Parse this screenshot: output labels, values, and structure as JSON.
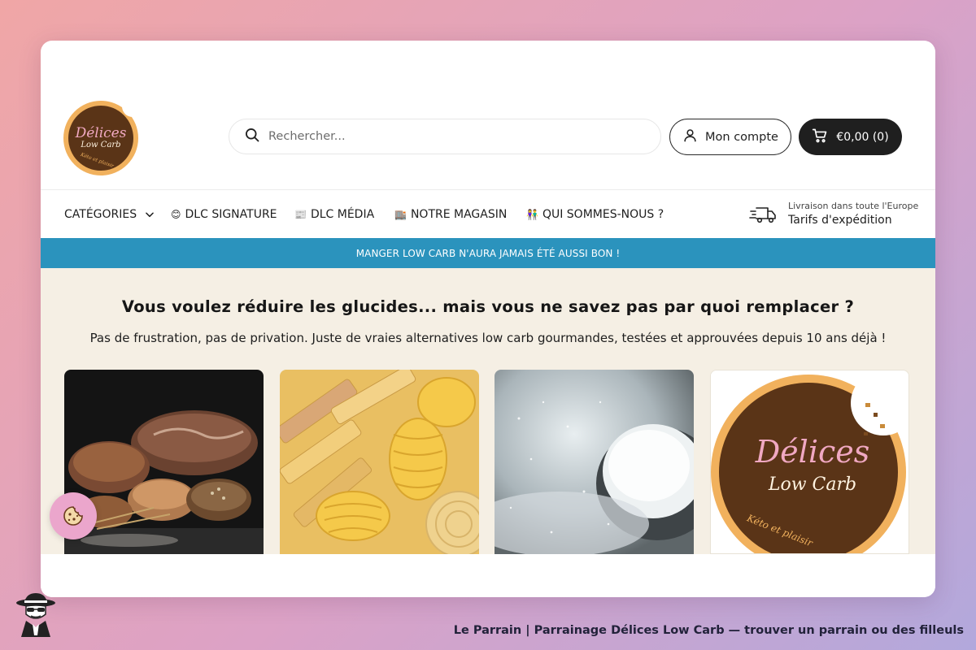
{
  "header": {
    "logo": {
      "line1": "Délices",
      "line2": "Low Carb",
      "tagline": "Kéto et plaisir"
    },
    "search": {
      "placeholder": "Rechercher...",
      "icon": "search-icon"
    },
    "account": {
      "label": "Mon compte",
      "icon": "user-icon"
    },
    "cart": {
      "label": "€0,00 (0)",
      "icon": "cart-icon"
    }
  },
  "nav": {
    "items": [
      {
        "label": "CATÉGORIES",
        "icon": "chevron-down-icon"
      },
      {
        "emoji": "😊",
        "label": "DLC SIGNATURE"
      },
      {
        "emoji": "📰",
        "label": "DLC MÉDIA"
      },
      {
        "emoji": "🏬",
        "label": "NOTRE MAGASIN"
      },
      {
        "emoji": "👫",
        "label": "QUI SOMMES-NOUS ?"
      }
    ],
    "shipping": {
      "icon": "delivery-truck-icon",
      "line1": "Livraison dans toute l'Europe",
      "line2": "Tarifs d'expédition"
    }
  },
  "announcement": {
    "text": "MANGER LOW CARB N'AURA JAMAIS ÉTÉ AUSSI BON !"
  },
  "hero": {
    "title": "Vous voulez réduire les glucides... mais vous ne savez pas par quoi remplacer ?",
    "subtitle": "Pas de frustration, pas de privation. Juste de vraies alternatives low carb gourmandes, testées et approuvées depuis 10 ans déjà !",
    "cards": [
      {
        "subject": "bread"
      },
      {
        "subject": "pasta"
      },
      {
        "subject": "sugar"
      },
      {
        "subject": "brand-logo",
        "line1": "Délices",
        "line2": "Low Carb",
        "tagline": "Kéto et plaisir"
      }
    ]
  },
  "cookie_button": {
    "icon": "cookie-icon"
  },
  "caption": {
    "text": "Le Parrain | Parrainage Délices Low Carb — trouver un parrain ou des filleuls"
  },
  "colors": {
    "announcement_bg": "#2b93bd",
    "hero_bg": "#f5efe4",
    "cart_bg": "#1f1f1f",
    "logo_brown": "#5a3417",
    "logo_orange": "#f1b15d",
    "logo_pink": "#f0a8c2"
  }
}
